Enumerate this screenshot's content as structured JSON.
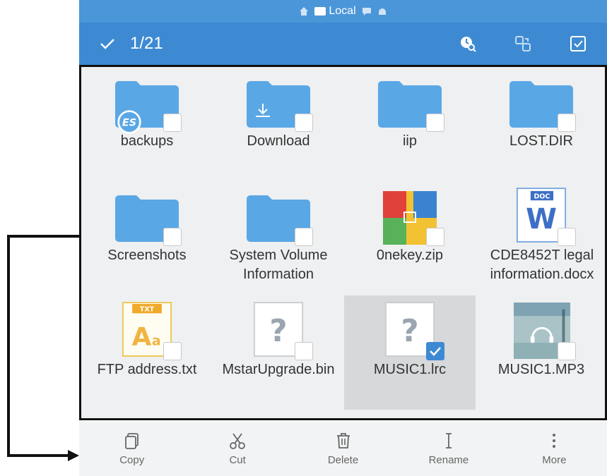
{
  "statusbar": {
    "location_label": "Local"
  },
  "titlebar": {
    "selection_count": "1/21"
  },
  "files": [
    {
      "name": "backups",
      "type": "folder-es"
    },
    {
      "name": "Download",
      "type": "folder-download"
    },
    {
      "name": "iip",
      "type": "folder"
    },
    {
      "name": "LOST.DIR",
      "type": "folder"
    },
    {
      "name": "Screenshots",
      "type": "folder"
    },
    {
      "name": "System Volume Information",
      "type": "folder"
    },
    {
      "name": "0nekey.zip",
      "type": "zip"
    },
    {
      "name": "CDE8452T legal information.docx",
      "type": "doc",
      "badge": "DOC"
    },
    {
      "name": "FTP address.txt",
      "type": "txt",
      "badge": "TXT"
    },
    {
      "name": "MstarUpgrade.bin",
      "type": "unknown"
    },
    {
      "name": "MUSIC1.lrc",
      "type": "unknown",
      "selected": true
    },
    {
      "name": "MUSIC1.MP3",
      "type": "audio-thumb"
    }
  ],
  "toolbar": {
    "copy": "Copy",
    "cut": "Cut",
    "delete": "Delete",
    "rename": "Rename",
    "more": "More"
  },
  "colors": {
    "accent": "#3d8ad3",
    "folder": "#5aa7e6",
    "selected_bg": "#d6d8da"
  },
  "icons": {
    "check": "check-icon",
    "search_history": "search-history-icon",
    "transfer": "transfer-icon",
    "select_all": "select-all-icon",
    "copy": "copy-icon",
    "cut": "scissors-icon",
    "delete": "trash-icon",
    "rename": "text-cursor-icon",
    "more": "more-vert-icon"
  }
}
